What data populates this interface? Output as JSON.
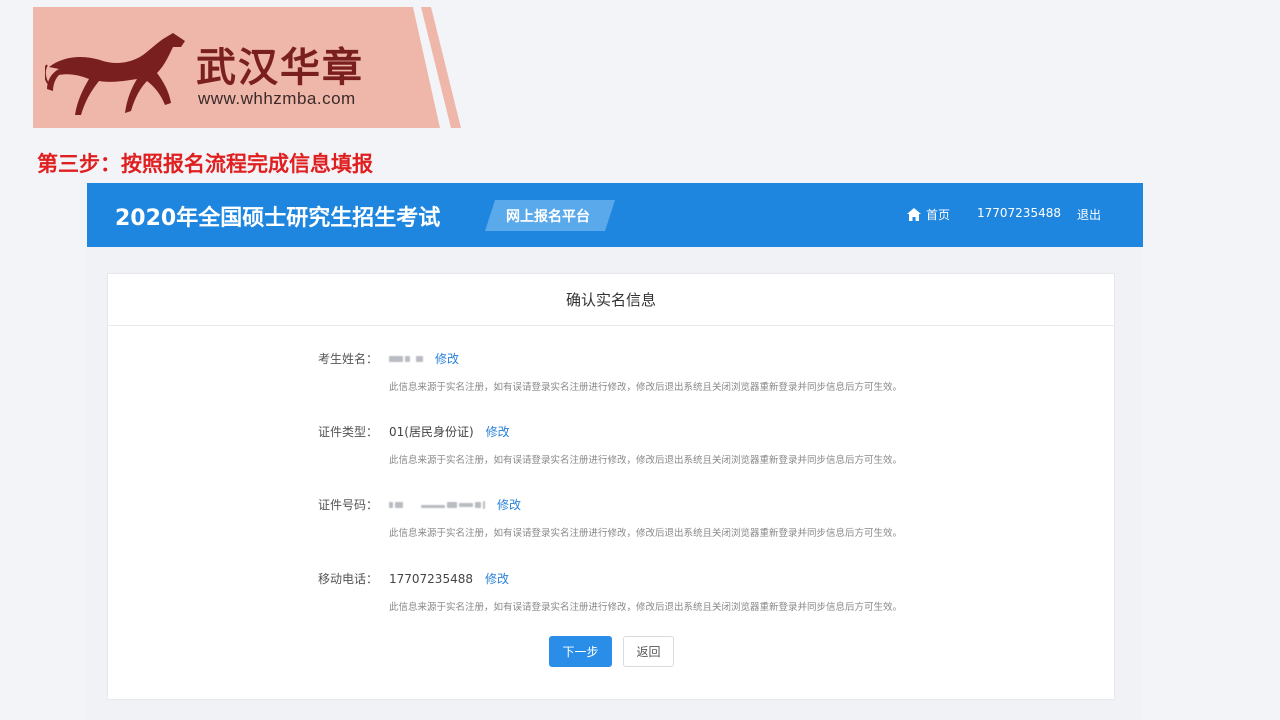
{
  "logo": {
    "name": "武汉华章",
    "url": "www.whhzmba.com",
    "bg_color": "#efb7a9"
  },
  "step_title": "第三步：按照报名流程完成信息填报",
  "header": {
    "title": "2020年全国硕士研究生招生考试",
    "platform": "网上报名平台",
    "home_label": "首页",
    "phone": "17707235488",
    "logout_label": "退出",
    "bg_color": "#1f86e0"
  },
  "card": {
    "title": "确认实名信息",
    "fields": [
      {
        "label": "考生姓名：",
        "value": "",
        "edit": "修改",
        "hint": "此信息来源于实名注册，如有误请登录实名注册进行修改，修改后退出系统且关闭浏览器重新登录并同步信息后方可生效。"
      },
      {
        "label": "证件类型：",
        "value": "01(居民身份证)",
        "edit": "修改",
        "hint": "此信息来源于实名注册，如有误请登录实名注册进行修改，修改后退出系统且关闭浏览器重新登录并同步信息后方可生效。"
      },
      {
        "label": "证件号码：",
        "value": "",
        "edit": "修改",
        "hint": "此信息来源于实名注册，如有误请登录实名注册进行修改，修改后退出系统且关闭浏览器重新登录并同步信息后方可生效。"
      },
      {
        "label": "移动电话：",
        "value": "17707235488",
        "edit": "修改",
        "hint": "此信息来源于实名注册，如有误请登录实名注册进行修改，修改后退出系统且关闭浏览器重新登录并同步信息后方可生效。"
      }
    ],
    "next_label": "下一步",
    "back_label": "返回"
  },
  "colors": {
    "accent": "#1f86e0",
    "link": "#2b82d9",
    "step_red": "#e02020"
  }
}
